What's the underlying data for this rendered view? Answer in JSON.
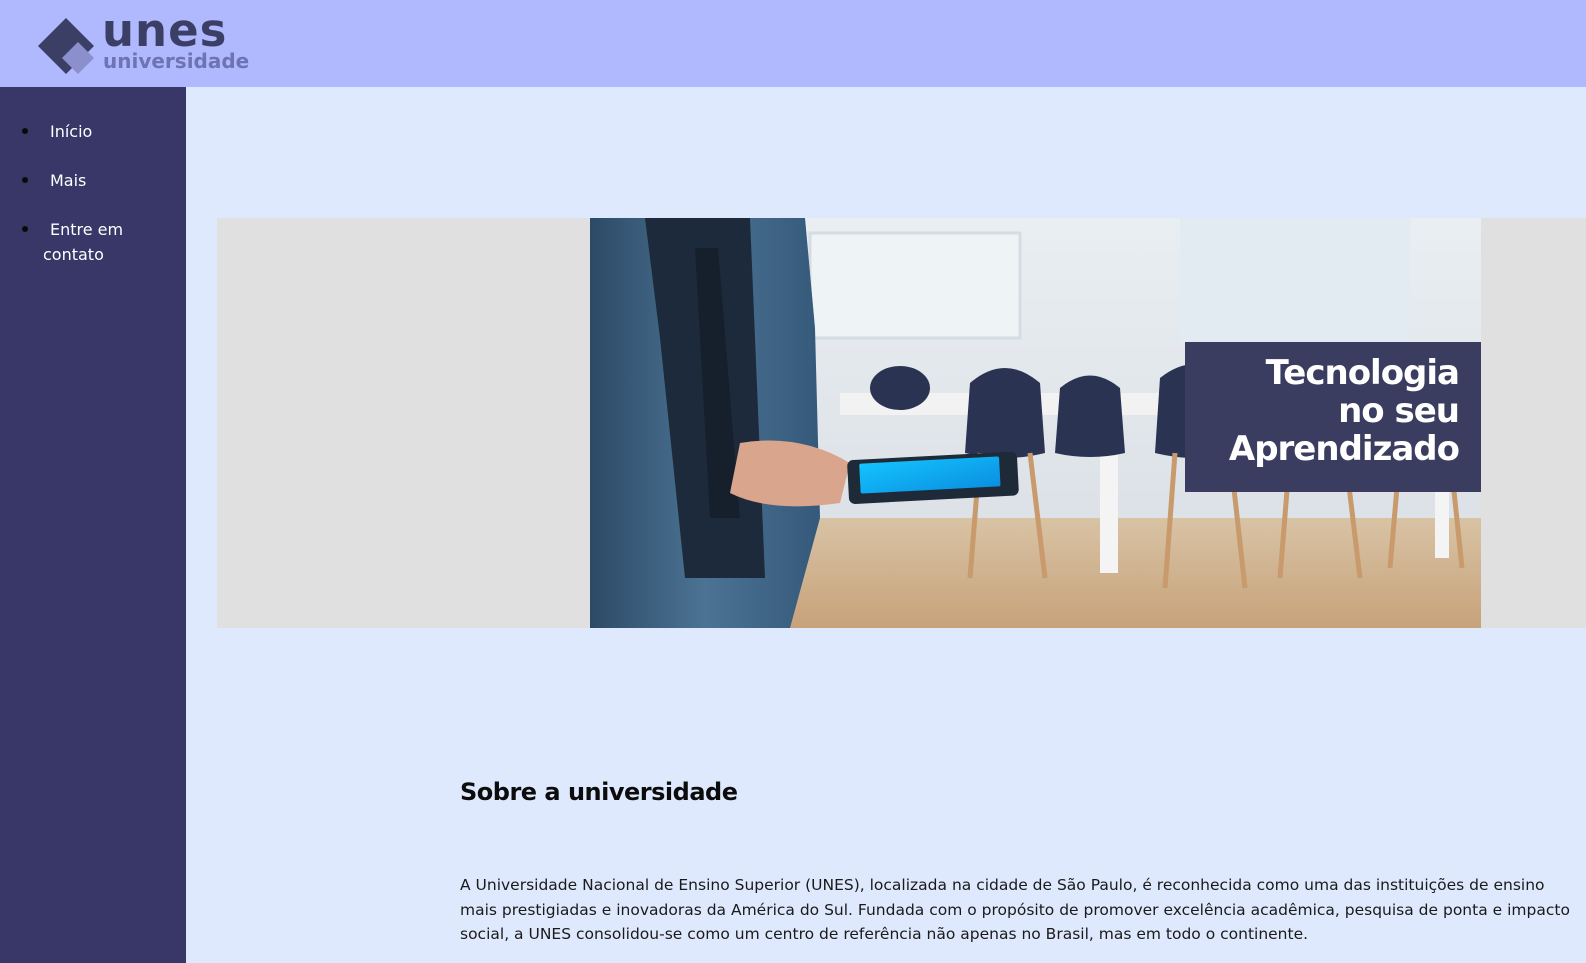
{
  "header": {
    "logo_main": "unes",
    "logo_sub": "universidade",
    "background_color": "#b0b8fe"
  },
  "sidebar": {
    "background_color": "#383767",
    "items": [
      {
        "label": "Início"
      },
      {
        "label": "Mais"
      },
      {
        "label_line1": "Entre em",
        "label_line2": "contato"
      }
    ]
  },
  "banner": {
    "caption_line1": "Tecnologia",
    "caption_line2": "no seu",
    "caption_line3": "Aprendizado"
  },
  "about": {
    "title": "Sobre a universidade",
    "text": "A Universidade Nacional de Ensino Superior (UNES), localizada na cidade de São Paulo, é reconhecida como uma das instituições de ensino mais prestigiadas e inovadoras da América do Sul. Fundada com o propósito de promover excelência acadêmica, pesquisa de ponta e impacto social, a UNES consolidou-se como um centro de referência não apenas no Brasil, mas em todo o continente."
  }
}
